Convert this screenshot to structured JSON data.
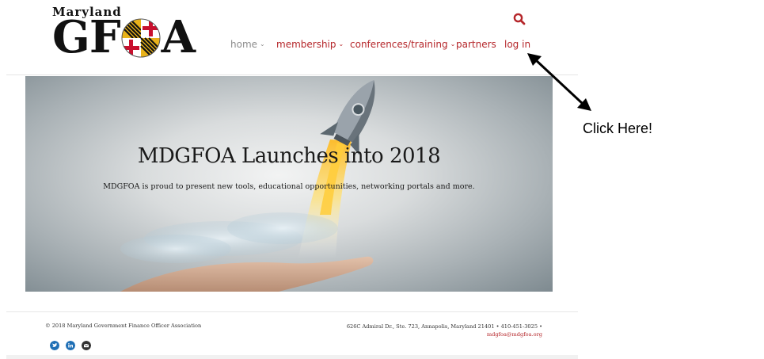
{
  "logo": {
    "top_text": "Maryland",
    "big_left": "GF",
    "big_right": "A"
  },
  "nav": {
    "items": [
      {
        "label": "home",
        "chevron": "⌄"
      },
      {
        "label": "membership",
        "chevron": "⌄"
      },
      {
        "label": "conferences/training",
        "chevron": "⌄"
      },
      {
        "label": "partners",
        "chevron": ""
      },
      {
        "label": "log in",
        "chevron": ""
      }
    ],
    "search_icon": "search-icon"
  },
  "hero": {
    "title": "MDGFOA Launches into 2018",
    "subtitle": "MDGFOA is proud to present new tools, educational opportunities, networking portals and more."
  },
  "footer": {
    "copyright": "© 2018 Maryland Government Finance Officer Association",
    "address": "626C Admiral Dr., Ste. 723, Annapolis, Maryland 21401 • 410-451-3025 •",
    "email": "mdgfoa@mdgfoa.org",
    "social": [
      "twitter-icon",
      "linkedin-icon",
      "email-icon"
    ]
  },
  "annotation": {
    "callout": "Click Here!"
  },
  "colors": {
    "accent": "#b5262a",
    "nav_muted": "#8c8c8c",
    "social": "#1f6fb5"
  }
}
